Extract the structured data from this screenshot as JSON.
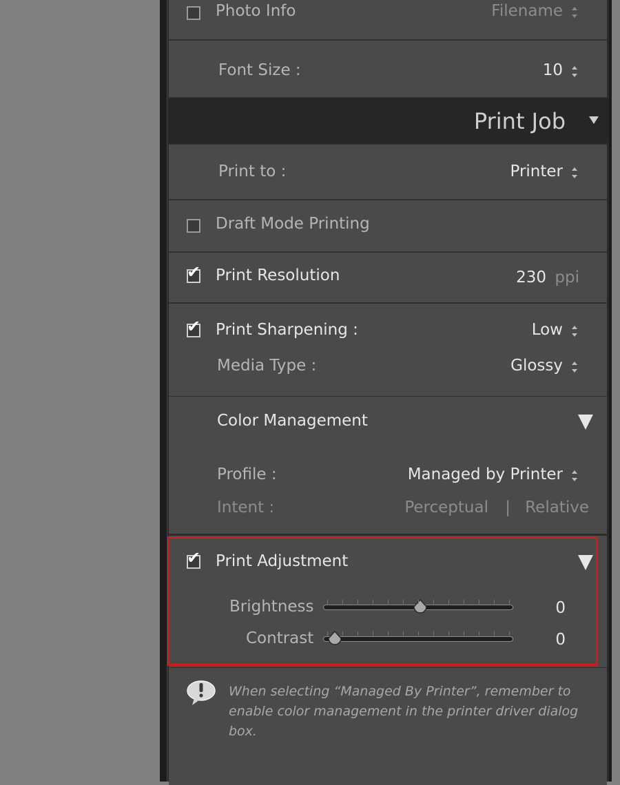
{
  "photo_info": {
    "label": "Photo Info",
    "checked": false,
    "value": "Filename"
  },
  "font_size": {
    "label": "Font Size :",
    "value": "10"
  },
  "print_job": {
    "title": "Print Job"
  },
  "print_to": {
    "label": "Print to :",
    "value": "Printer"
  },
  "draft_mode": {
    "label": "Draft Mode Printing",
    "checked": false
  },
  "print_resolution": {
    "label": "Print Resolution",
    "checked": true,
    "value": "230",
    "unit": "ppi"
  },
  "print_sharpening": {
    "label": "Print Sharpening :",
    "checked": true,
    "value": "Low",
    "media_label": "Media Type :",
    "media_value": "Glossy"
  },
  "color_management": {
    "title": "Color Management",
    "profile_label": "Profile :",
    "profile_value": "Managed by Printer",
    "intent_label": "Intent :",
    "intent_options": [
      "Perceptual",
      "Relative"
    ],
    "intent_separator": "|"
  },
  "print_adjustment": {
    "title": "Print Adjustment",
    "checked": true,
    "brightness_label": "Brightness",
    "brightness_value": "0",
    "brightness_fraction": 0.5,
    "contrast_label": "Contrast",
    "contrast_value": "0",
    "contrast_fraction": 0.0
  },
  "note": {
    "text": "When selecting “Managed By Printer”, remember to enable color management in the printer driver dialog box."
  },
  "colors": {
    "panel_bg": "#4a4a4a",
    "header_bg": "#262626",
    "highlight": "#d61a1a",
    "text_bright": "#e6e6e6",
    "text_dim": "#8c8c8c"
  }
}
